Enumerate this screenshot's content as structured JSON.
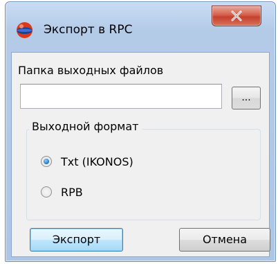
{
  "window": {
    "title": "Экспорт в RPC",
    "icon": "sphere-app-icon",
    "close_icon": "close-x-icon"
  },
  "output_folder": {
    "label": "Папка выходных файлов",
    "value": "",
    "browse_label": "..."
  },
  "output_format": {
    "group_title": "Выходной формат",
    "options": [
      {
        "label": "Txt (IKONOS)",
        "selected": true
      },
      {
        "label": "RPB",
        "selected": false
      }
    ]
  },
  "buttons": {
    "export_label": "Экспорт",
    "cancel_label": "Отмена"
  },
  "colors": {
    "title_bar": "#b9cfeb",
    "close_button": "#c9452f",
    "default_button_border": "#3c7fb1",
    "dialog_background": "#f0f0f0"
  }
}
